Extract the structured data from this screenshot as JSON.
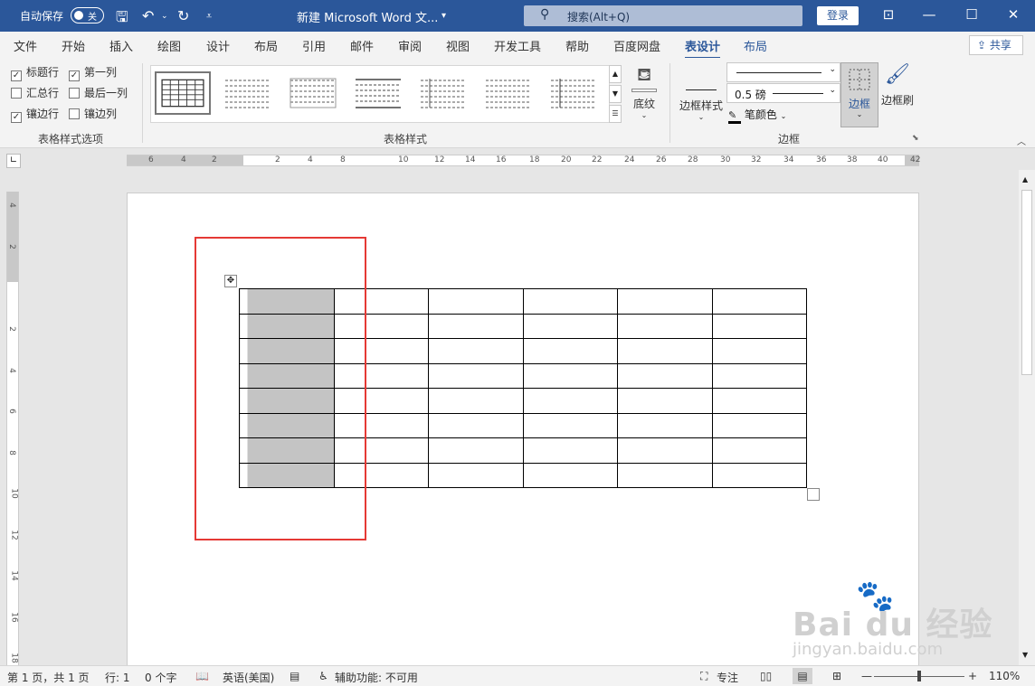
{
  "titlebar": {
    "autosave_label": "自动保存",
    "autosave_state": "关",
    "doc_title": "新建 Microsoft Word 文...",
    "search_placeholder": "搜索(Alt+Q)",
    "login_label": "登录"
  },
  "tabs": [
    "文件",
    "开始",
    "插入",
    "绘图",
    "设计",
    "布局",
    "引用",
    "邮件",
    "审阅",
    "视图",
    "开发工具",
    "帮助",
    "百度网盘",
    "表设计",
    "布局"
  ],
  "active_tab": "表设计",
  "share_label": "共享",
  "ribbon": {
    "style_options": {
      "header_row": "标题行",
      "first_column": "第一列",
      "total_row": "汇总行",
      "last_column": "最后一列",
      "banded_rows": "镶边行",
      "banded_columns": "镶边列",
      "group_label": "表格样式选项"
    },
    "table_styles_label": "表格样式",
    "shading_label": "底纹",
    "border_styles_label": "边框样式",
    "pen_weight": "0.5 磅",
    "pen_color_label": "笔颜色",
    "borders_label": "边框",
    "border_painter_label": "边框刷",
    "borders_group_label": "边框"
  },
  "hruler_numbers": [
    "6",
    "4",
    "2",
    "2",
    "4",
    "8",
    "10",
    "12",
    "14",
    "16",
    "18",
    "20",
    "22",
    "24",
    "26",
    "28",
    "30",
    "32",
    "34",
    "36",
    "38",
    "40",
    "42"
  ],
  "vruler_numbers": [
    "4",
    "2",
    "2",
    "4",
    "6",
    "8",
    "10",
    "12",
    "14",
    "16",
    "18"
  ],
  "table": {
    "rows": 8,
    "cols": 6
  },
  "statusbar": {
    "page": "第 1 页，共 1 页",
    "line": "行: 1",
    "words": "0 个字",
    "language": "英语(美国)",
    "accessibility": "辅助功能: 不可用",
    "focus": "专注",
    "zoom": "110%"
  },
  "watermark": {
    "brand": "Bai du 经验",
    "url": "jingyan.baidu.com"
  },
  "colors": {
    "accent": "#2b579a",
    "highlight": "#e53935",
    "shaded_cell": "#c4c4c4"
  }
}
